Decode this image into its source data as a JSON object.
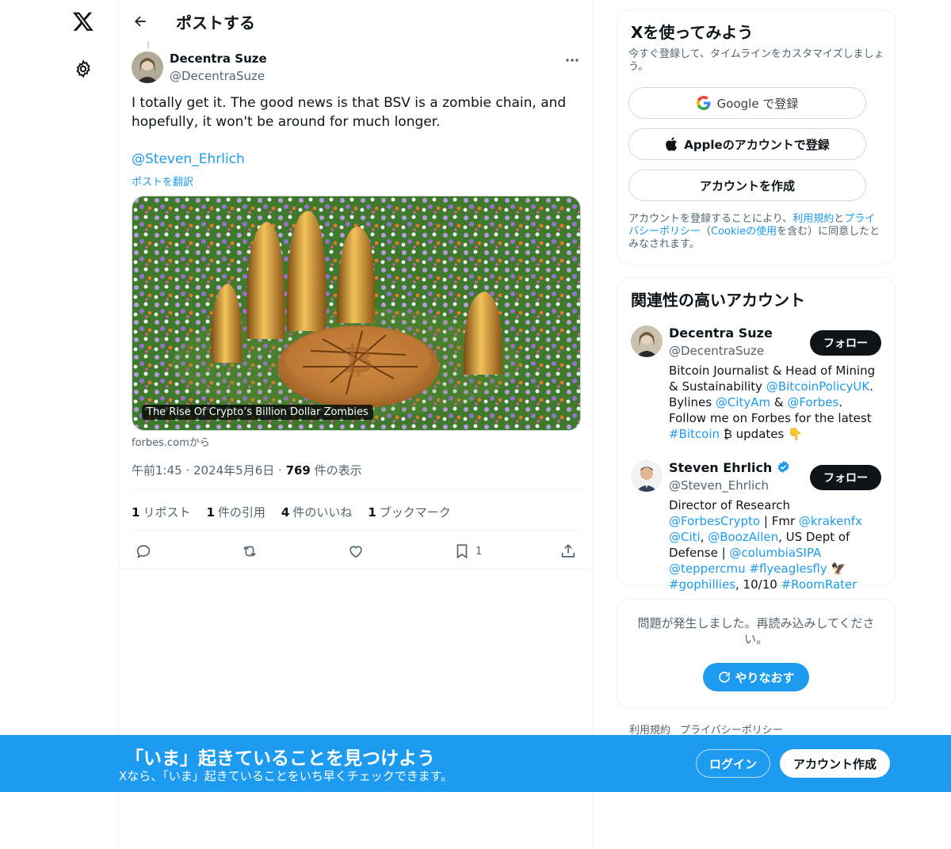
{
  "colors": {
    "accent": "#1d9bf0",
    "text": "#0f1419",
    "muted": "#536471",
    "border": "#eff3f4"
  },
  "nav": {
    "logo_icon": "x-logo-icon",
    "settings_icon": "gear-icon"
  },
  "header": {
    "title": "ポストする"
  },
  "post": {
    "author": {
      "name": "Decentra Suze",
      "handle": "@DecentraSuze"
    },
    "text": "I totally get it. The good news is that BSV is a zombie chain, and hopefully, it won't be around for much longer.",
    "mention": "@Steven_Ehrlich",
    "translate": "ポストを翻訳",
    "card": {
      "caption": "The Rise Of Crypto’s Billion Dollar Zombies",
      "source": "forbes.comから"
    },
    "meta": {
      "time": "午前1:45 · 2024年5月6日 · ",
      "views": "769",
      "views_label": " 件の表示"
    },
    "stats": [
      {
        "count": "1",
        "label": "リポスト"
      },
      {
        "count": "1",
        "label": "件の引用"
      },
      {
        "count": "4",
        "label": "件のいいね"
      },
      {
        "count": "1",
        "label": "ブックマーク"
      }
    ],
    "bookmark_count": "1"
  },
  "signup": {
    "title": "Xを使ってみよう",
    "subtitle": "今すぐ登録して、タイムラインをカスタマイズしましょう。",
    "google": "Google で登録",
    "apple": "Appleのアカウントで登録",
    "create": "アカウントを作成",
    "legal": {
      "a": "アカウントを登録することにより、",
      "terms": "利用規約",
      "b": "と",
      "privacy": "プライバシーポリシー",
      "c": "（",
      "cookie": "Cookieの使用",
      "d": "を含む）に同意したとみなされます。"
    }
  },
  "relevant": {
    "title": "関連性の高いアカウント",
    "follow_label": "フォロー",
    "accounts": [
      {
        "name": "Decentra Suze",
        "handle": "@DecentraSuze",
        "bio": {
          "p1": "Bitcoin Journalist & Head of Mining & Sustainability ",
          "l1": "@BitcoinPolicyUK",
          "p2": ". Bylines ",
          "l2": "@CityAm",
          "p3": " & ",
          "l3": "@Forbes",
          "p4": ". Follow me on Forbes for the latest ",
          "l4": "#Bitcoin",
          "p5": " ₿ updates 👇"
        }
      },
      {
        "name": "Steven Ehrlich",
        "handle": "@Steven_Ehrlich",
        "bio": {
          "p1": "Director of Research ",
          "l1": "@ForbesCrypto",
          "p2": " | Fmr ",
          "l2": "@krakenfx",
          "p2b": " ",
          "l2b": "@Citi",
          "p3": ", ",
          "l3": "@BoozAllen",
          "p4": ", US Dept of Defense | ",
          "l4": "@columbiaSIPA",
          "p5": " ",
          "l5": "@teppercmu",
          "p6": " ",
          "l6": "#flyeaglesfly",
          "p7": " 🦅 ",
          "l7": "#gophillies",
          "p8": ", 10/10 ",
          "l8": "#RoomRater"
        }
      }
    ]
  },
  "error": {
    "text": "問題が発生しました。再読み込みしてください。",
    "retry": "やりなおす"
  },
  "footer": {
    "terms": "利用規約",
    "privacy": "プライバシーポリシー"
  },
  "banner": {
    "title": "「いま」起きていることを見つけよう",
    "subtitle": "Xなら、「いま」起きていることをいち早くチェックできます。",
    "login": "ログイン",
    "create": "アカウント作成"
  }
}
